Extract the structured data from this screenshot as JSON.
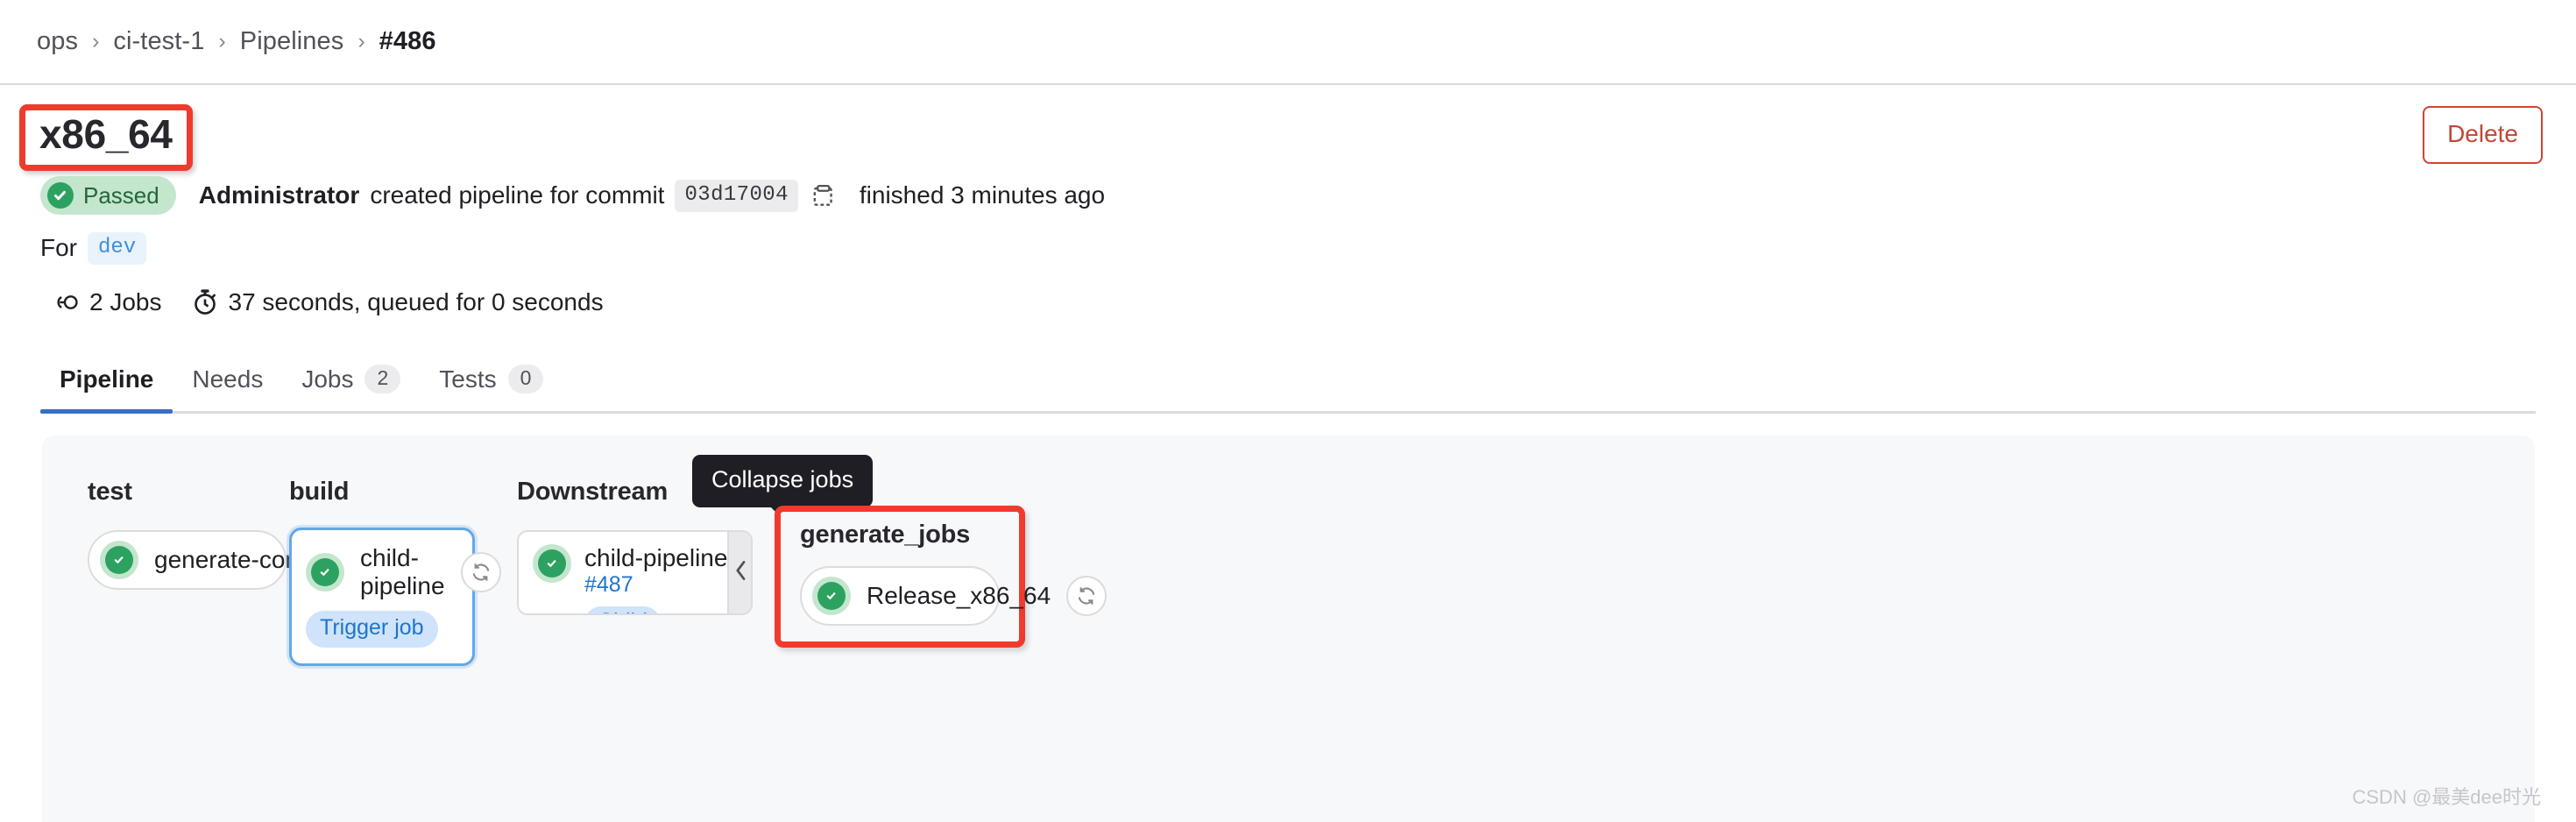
{
  "breadcrumb": {
    "items": [
      {
        "label": "ops"
      },
      {
        "label": "ci-test-1"
      },
      {
        "label": "Pipelines"
      },
      {
        "label": "#486"
      }
    ],
    "separator": "›"
  },
  "header": {
    "title": "x86_64",
    "delete_label": "Delete"
  },
  "status": {
    "badge_label": "Passed",
    "author": "Administrator",
    "action_text": "created pipeline for commit",
    "commit_sha": "03d17004",
    "copy_icon": "copy-to-clipboard-icon",
    "finished_text": "finished 3 minutes ago",
    "for_label": "For",
    "branch": "dev",
    "jobs_icon": "pipeline-jobs-icon",
    "jobs_count": "2 Jobs",
    "duration_icon": "stopwatch-icon",
    "duration_text": "37 seconds, queued for 0 seconds"
  },
  "tabs": [
    {
      "label": "Pipeline",
      "badge": null,
      "active": true
    },
    {
      "label": "Needs",
      "badge": null,
      "active": false
    },
    {
      "label": "Jobs",
      "badge": "2",
      "active": false
    },
    {
      "label": "Tests",
      "badge": "0",
      "active": false
    }
  ],
  "graph": {
    "stages": {
      "test": {
        "title": "test",
        "job": {
          "name": "generate-config",
          "status": "passed",
          "retry_icon": "retry-icon"
        }
      },
      "build": {
        "title": "build",
        "job": {
          "name": "child-pipeline",
          "status": "passed",
          "badge": "Trigger job",
          "retry_icon": "retry-icon"
        }
      },
      "downstream": {
        "title": "Downstream",
        "card": {
          "name": "child-pipeline",
          "pipeline_id": "#487",
          "badge": "Child",
          "status": "passed",
          "collapse_icon": "chevron-left-icon"
        },
        "tooltip": "Collapse jobs"
      },
      "generate_jobs": {
        "title": "generate_jobs",
        "job": {
          "name": "Release_x86_64",
          "status": "passed",
          "retry_icon": "retry-icon"
        }
      }
    }
  },
  "watermark": "CSDN @最美dee时光",
  "colors": {
    "accent_blue": "#1f75cb",
    "annotation_red": "#ef3b2d",
    "success_green": "#2da160",
    "success_bg": "#c3e6cd",
    "graph_bg": "#f7f8fa",
    "delete_red": "#c14733"
  }
}
